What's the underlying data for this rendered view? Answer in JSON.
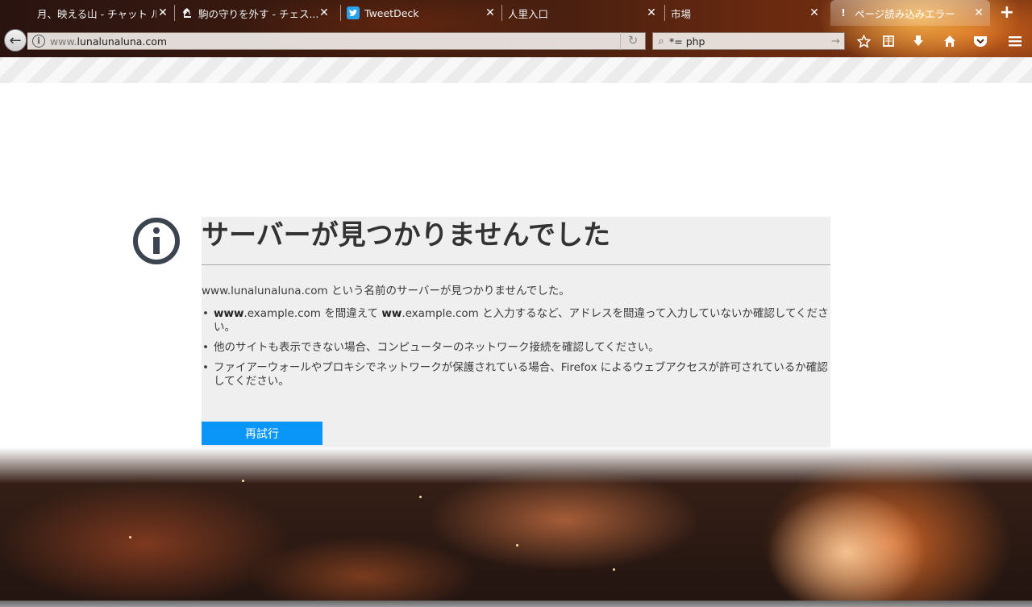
{
  "tabs": [
    {
      "title": "月、映える山 - チャット ルブル",
      "favicon": "none",
      "active": false
    },
    {
      "title": "駒の守りを外す - チェス...",
      "favicon": "chess-knight-icon",
      "active": false
    },
    {
      "title": "TweetDeck",
      "favicon": "twitter-bird-icon",
      "active": false
    },
    {
      "title": "人里入口",
      "favicon": "none",
      "active": false
    },
    {
      "title": "市場",
      "favicon": "none",
      "active": false
    },
    {
      "title": "ページ読み込みエラー",
      "favicon": "warning-icon",
      "active": true
    }
  ],
  "url": {
    "prefix": "www.",
    "host": "lunalunaluna.com"
  },
  "search": {
    "query": "*= php"
  },
  "toolbar_icons": [
    "star-icon",
    "reading-list-icon",
    "download-icon",
    "home-icon",
    "pocket-icon",
    "menu-icon"
  ],
  "error": {
    "title": "サーバーが見つかりませんでした",
    "description": "www.lunalunaluna.com という名前のサーバーが見つかりませんでした。",
    "bullets": [
      {
        "bold1": "www",
        "t1": ".example.com を間違えて ",
        "bold2": "ww",
        "t2": ".example.com と入力するなど、アドレスを間違って入力していないか確認してください。"
      },
      {
        "text": "他のサイトも表示できない場合、コンピューターのネットワーク接続を確認してください。"
      },
      {
        "text": "ファイアーウォールやプロキシでネットワークが保護されている場合、Firefox によるウェブアクセスが許可されているか確認してください。"
      }
    ],
    "retry_label": "再試行"
  },
  "colors": {
    "accent": "#0996f8",
    "title": "#333333",
    "box_bg": "#efefef"
  }
}
